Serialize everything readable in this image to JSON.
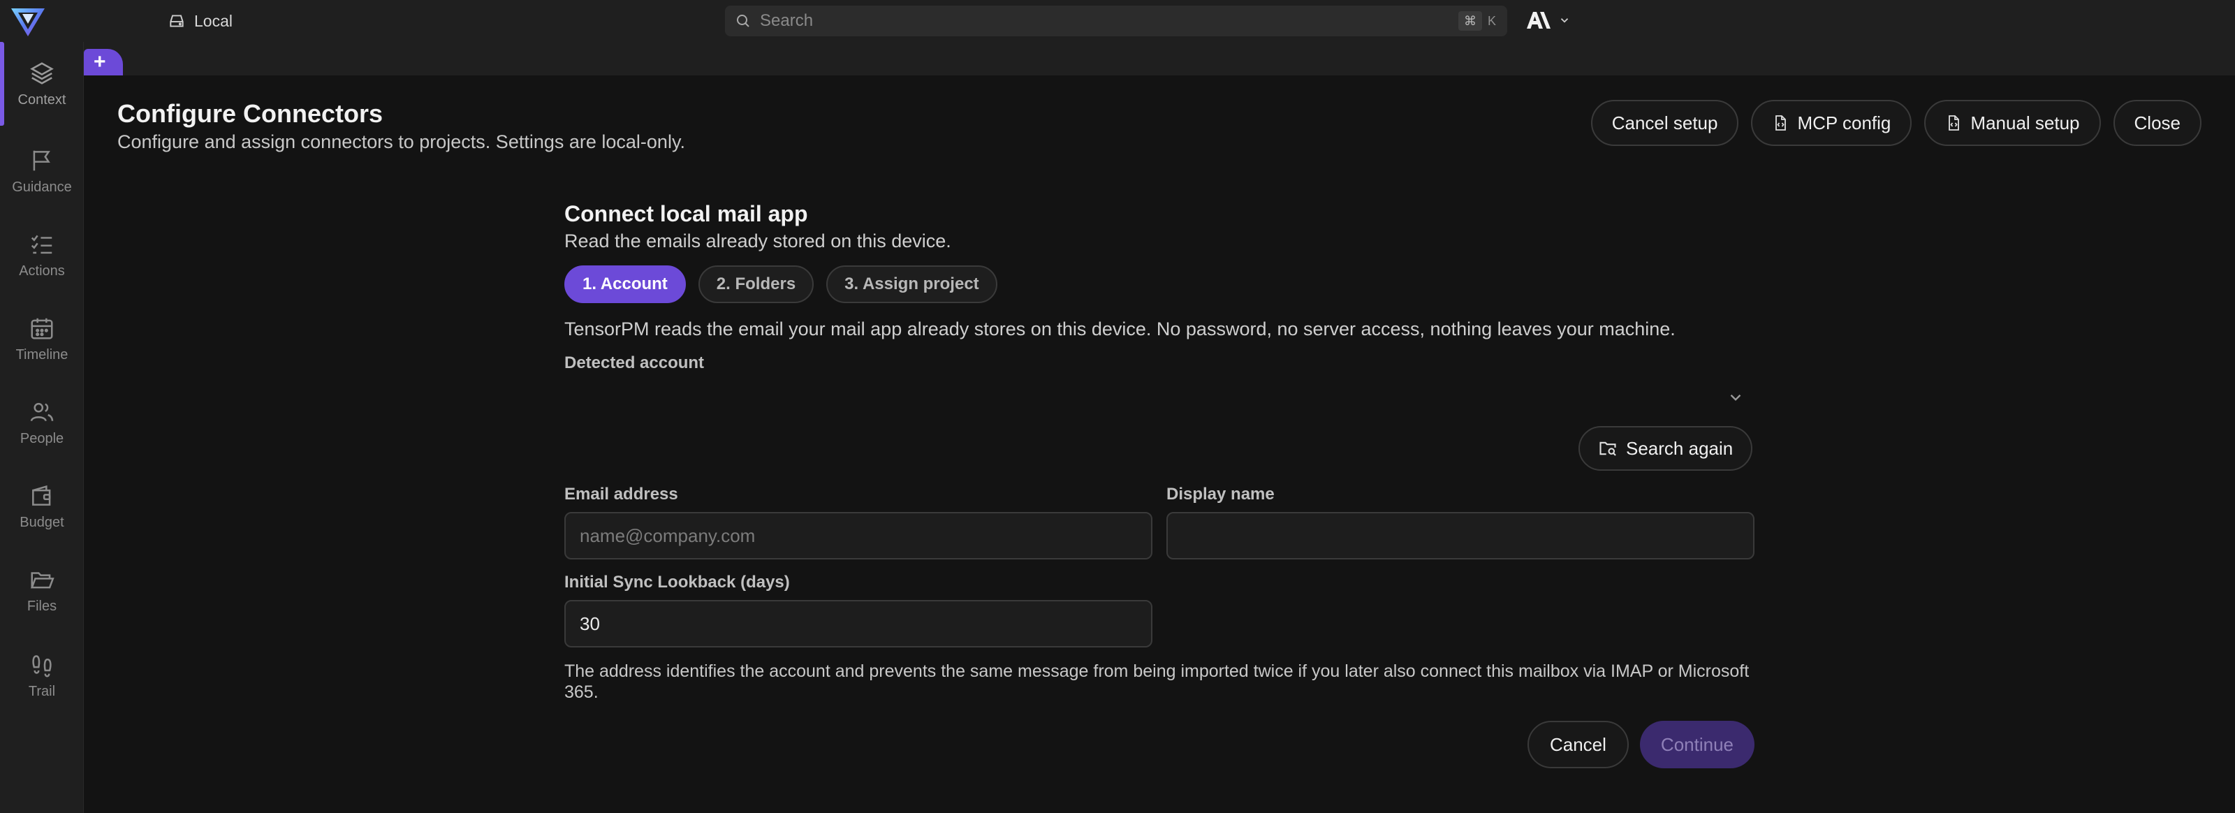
{
  "topbar": {
    "workspace_label": "Local",
    "search_placeholder": "Search",
    "shortcut_mod": "⌘",
    "shortcut_key": "K"
  },
  "sidebar": {
    "items": [
      {
        "label": "Context",
        "icon": "layers-icon",
        "active": true
      },
      {
        "label": "Guidance",
        "icon": "flag-icon"
      },
      {
        "label": "Actions",
        "icon": "checklist-icon"
      },
      {
        "label": "Timeline",
        "icon": "calendar-icon"
      },
      {
        "label": "People",
        "icon": "people-icon"
      },
      {
        "label": "Budget",
        "icon": "wallet-icon"
      },
      {
        "label": "Files",
        "icon": "folder-open-icon"
      },
      {
        "label": "Trail",
        "icon": "footprints-icon"
      }
    ]
  },
  "tabs": {
    "add_label": "+"
  },
  "header": {
    "title": "Configure Connectors",
    "subtitle": "Configure and assign connectors to projects. Settings are local-only.",
    "buttons": {
      "cancel_setup": "Cancel setup",
      "mcp_config": "MCP config",
      "manual_setup": "Manual setup",
      "close": "Close"
    }
  },
  "wizard": {
    "title": "Connect local mail app",
    "subtitle": "Read the emails already stored on this device.",
    "steps": [
      "1. Account",
      "2. Folders",
      "3. Assign project"
    ],
    "intro": "TensorPM reads the email your mail app already stores on this device. No password, no server access, nothing leaves your machine.",
    "detected_label": "Detected account",
    "search_again": "Search again",
    "email_label": "Email address",
    "email_placeholder": "name@company.com",
    "email_value": "",
    "display_label": "Display name",
    "display_value": "",
    "lookback_label": "Initial Sync Lookback (days)",
    "lookback_value": "30",
    "help": "The address identifies the account and prevents the same message from being imported twice if you later also connect this mailbox via IMAP or Microsoft 365.",
    "cancel": "Cancel",
    "continue": "Continue"
  },
  "colors": {
    "accent": "#6c4ad8",
    "background": "#131313",
    "surface": "#1f1f1f"
  }
}
